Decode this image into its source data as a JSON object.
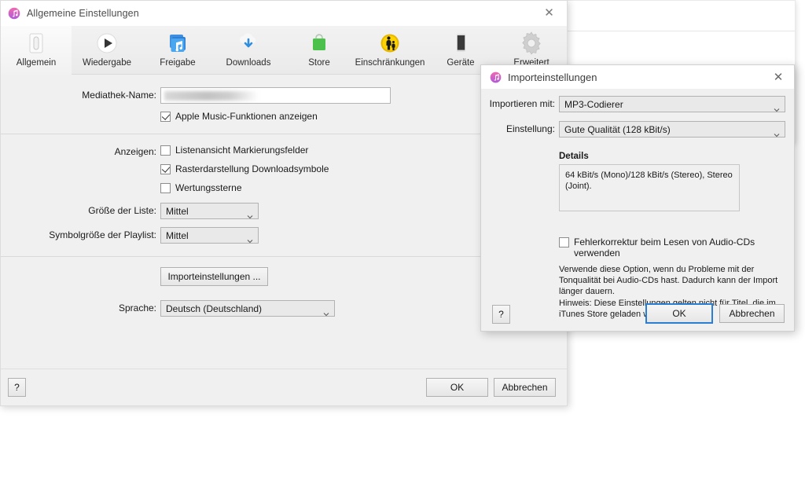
{
  "background_window": {
    "name": "background-app-window"
  },
  "main_window": {
    "title": "Allgemeine Einstellungen",
    "app_icon": "itunes-note-icon",
    "close_icon": "close-icon",
    "toolbar": [
      {
        "id": "allgemein",
        "label": "Allgemein",
        "icon": "general-device-icon",
        "selected": true
      },
      {
        "id": "wiedergabe",
        "label": "Wiedergabe",
        "icon": "play-circle-icon",
        "selected": false
      },
      {
        "id": "freigabe",
        "label": "Freigabe",
        "icon": "sharing-stack-icon",
        "selected": false
      },
      {
        "id": "downloads",
        "label": "Downloads",
        "icon": "cloud-download-icon",
        "selected": false
      },
      {
        "id": "store",
        "label": "Store",
        "icon": "shopping-bag-icon",
        "selected": false
      },
      {
        "id": "einschraenkungen",
        "label": "Einschränkungen",
        "icon": "parental-controls-icon",
        "selected": false
      },
      {
        "id": "geraete",
        "label": "Geräte",
        "icon": "iphone-device-icon",
        "selected": false
      },
      {
        "id": "erweitert",
        "label": "Erweitert",
        "icon": "gear-icon",
        "selected": false
      }
    ],
    "fields": {
      "library_name_label": "Mediathek-Name:",
      "library_name_value": "",
      "apple_music_label": "Apple Music-Funktionen anzeigen",
      "apple_music_checked": true,
      "show_label": "Anzeigen:",
      "list_view_label": "Listenansicht Markierungsfelder",
      "list_view_checked": false,
      "grid_view_label": "Rasterdarstellung Downloadsymbole",
      "grid_view_checked": true,
      "rating_stars_label": "Wertungssterne",
      "rating_stars_checked": false,
      "list_size_label": "Größe der Liste:",
      "list_size_value": "Mittel",
      "playlist_icon_size_label": "Symbolgröße der Playlist:",
      "playlist_icon_size_value": "Mittel",
      "import_settings_button": "Importeinstellungen ...",
      "language_label": "Sprache:",
      "language_value": "Deutsch (Deutschland)"
    },
    "footer": {
      "help_label": "?",
      "ok_label": "OK",
      "cancel_label": "Abbrechen"
    }
  },
  "dialog": {
    "title": "Importeinstellungen",
    "app_icon": "itunes-note-icon",
    "close_icon": "close-icon",
    "import_with_label": "Importieren mit:",
    "import_with_value": "MP3-Codierer",
    "setting_label": "Einstellung:",
    "setting_value": "Gute Qualität (128 kBit/s)",
    "details_heading": "Details",
    "details_text": "64 kBit/s (Mono)/128 kBit/s (Stereo), Stereo (Joint).",
    "error_correction_label": "Fehlerkorrektur beim Lesen von Audio-CDs verwenden",
    "error_correction_checked": false,
    "hint_text_1": "Verwende diese Option, wenn du Probleme mit der Tonqualität bei Audio-CDs hast. Dadurch kann der Import länger dauern.",
    "hint_text_2": "Hinweis: Diese Einstellungen gelten nicht für Titel, die im iTunes Store geladen wurden.",
    "help_label": "?",
    "ok_label": "OK",
    "cancel_label": "Abbrechen",
    "ok_focused": true
  },
  "colors": {
    "window_bg": "#f0f0f0",
    "titlebar_bg": "#ffffff",
    "focus_blue": "#2a7fd4",
    "store_green": "#4bc14b",
    "restrictions_yellow": "#f2c812",
    "share_blue": "#3b9fe8",
    "download_blue": "#2f8ede"
  }
}
